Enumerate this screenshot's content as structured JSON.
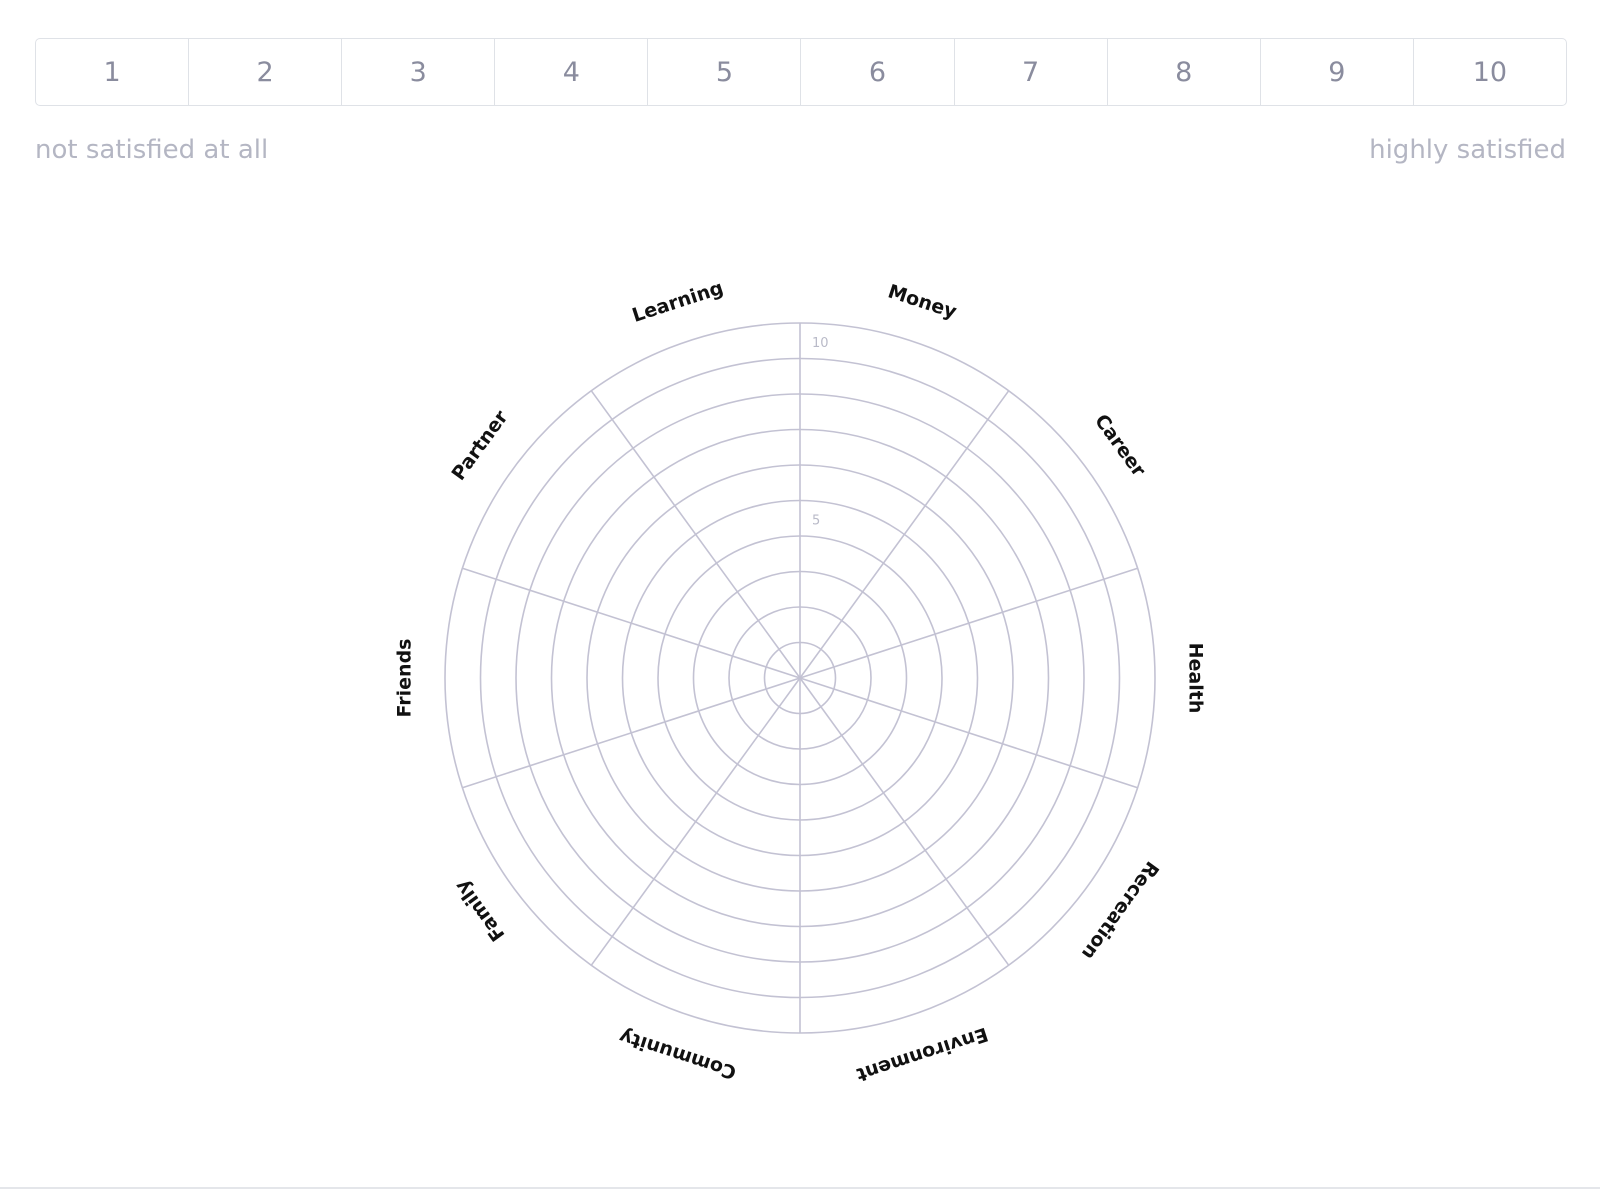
{
  "rating_scale": {
    "options": [
      "1",
      "2",
      "3",
      "4",
      "5",
      "6",
      "7",
      "8",
      "9",
      "10"
    ],
    "min_caption": "not satisfied at all",
    "max_caption": "highly satisfied"
  },
  "wheel": {
    "categories": [
      "Money",
      "Career",
      "Health",
      "Recreation",
      "Environment",
      "Community",
      "Family",
      "Friends",
      "Partner",
      "Learning"
    ],
    "max_value": 10,
    "ring_count": 10,
    "scale_labels": [
      "5",
      "10"
    ],
    "scores": [
      null,
      null,
      null,
      null,
      null,
      null,
      null,
      null,
      null,
      null
    ],
    "colors": {
      "grid": "#c3c2d3",
      "label": "#111111",
      "scale_label": "#b9bac8"
    }
  }
}
